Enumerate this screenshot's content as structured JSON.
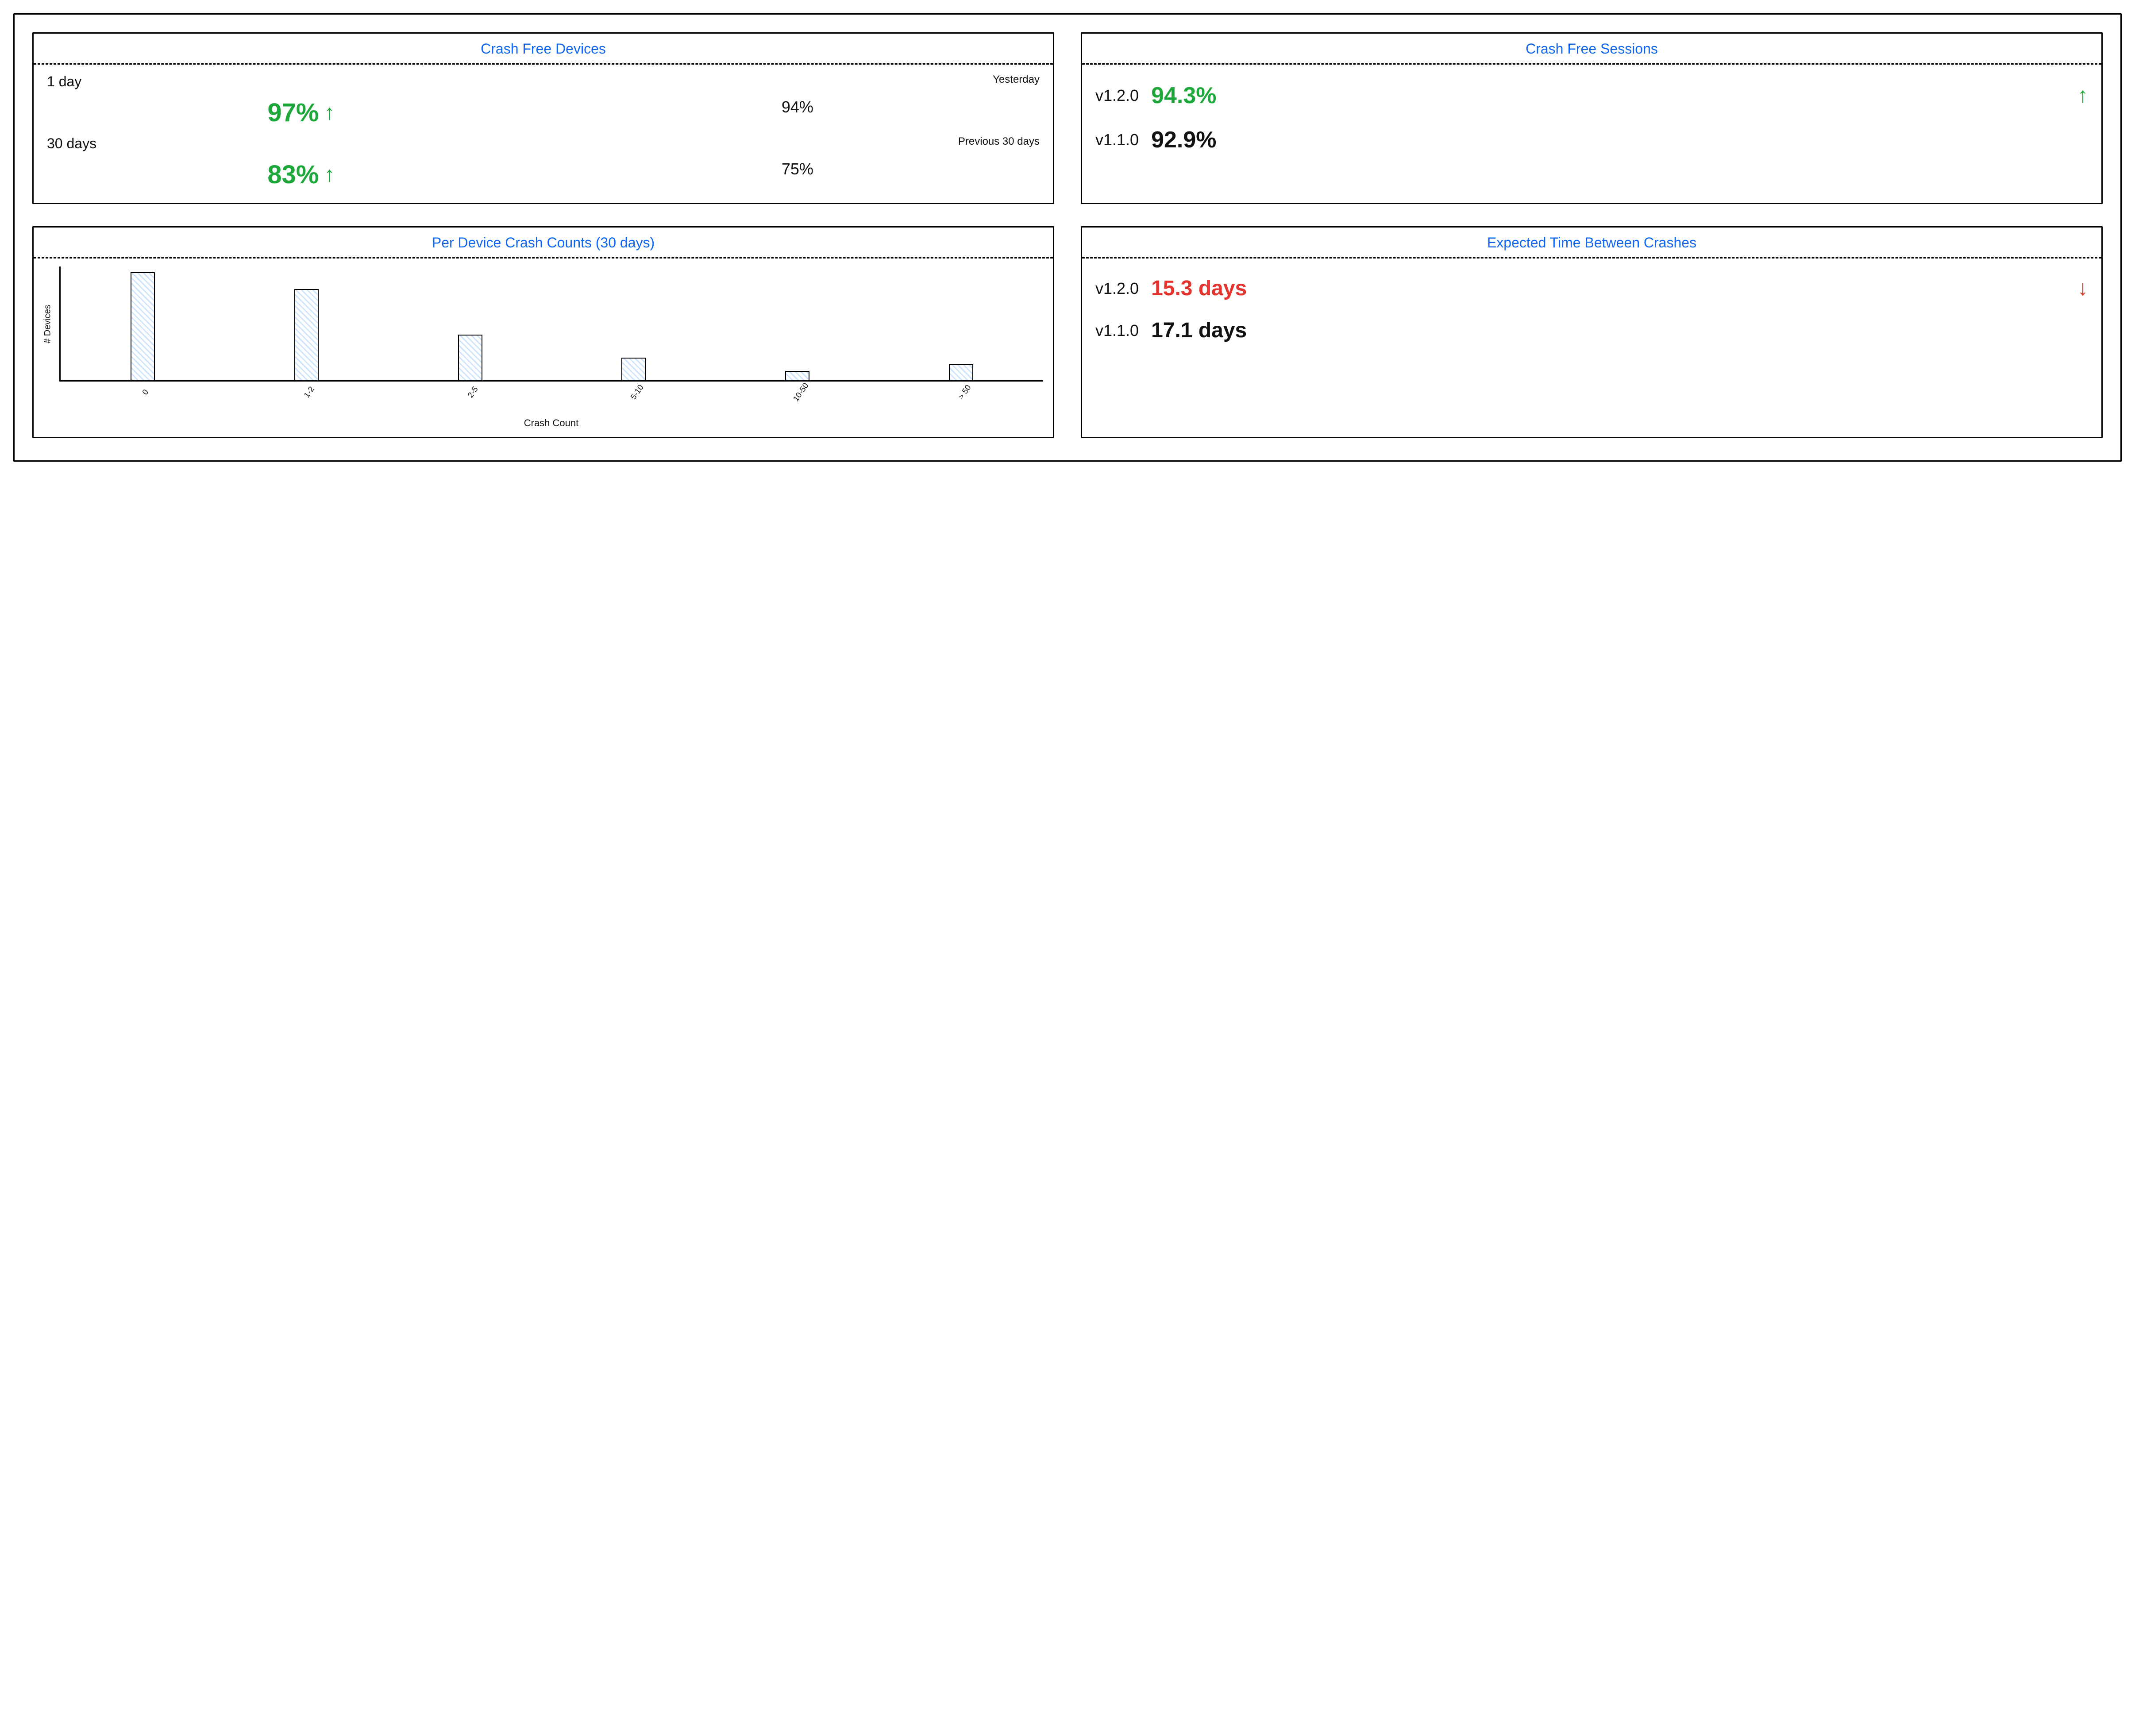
{
  "colors": {
    "accent_blue": "#1166ee",
    "good_green": "#1ea83b",
    "bad_red": "#e3342f"
  },
  "cards": {
    "crash_free_devices": {
      "title": "Crash Free Devices",
      "rows": [
        {
          "period_label": "1 day",
          "value": "97%",
          "trend": "up",
          "compare_label": "Yesterday",
          "compare_value": "94%"
        },
        {
          "period_label": "30 days",
          "value": "83%",
          "trend": "up",
          "compare_label": "Previous 30 days",
          "compare_value": "75%"
        }
      ]
    },
    "crash_free_sessions": {
      "title": "Crash Free Sessions",
      "rows": [
        {
          "version": "v1.2.0",
          "value": "94.3%",
          "highlight": "green",
          "trend": "up"
        },
        {
          "version": "v1.1.0",
          "value": "92.9%",
          "highlight": null,
          "trend": null
        }
      ]
    },
    "per_device_crash_counts": {
      "title": "Per Device Crash Counts (30 days)"
    },
    "expected_time_between_crashes": {
      "title": "Expected Time Between Crashes",
      "rows": [
        {
          "version": "v1.2.0",
          "value": "15.3 days",
          "highlight": "red",
          "trend": "down"
        },
        {
          "version": "v1.1.0",
          "value": "17.1 days",
          "highlight": null,
          "trend": null
        }
      ]
    }
  },
  "chart_data": {
    "type": "bar",
    "title": "Per Device Crash Counts (30 days)",
    "xlabel": "Crash Count",
    "ylabel": "# Devices",
    "categories": [
      "0",
      "1-2",
      "2-5",
      "5-10",
      "10-50",
      "> 50"
    ],
    "values": [
      95,
      80,
      40,
      20,
      8,
      14
    ],
    "ylim": [
      0,
      100
    ]
  }
}
